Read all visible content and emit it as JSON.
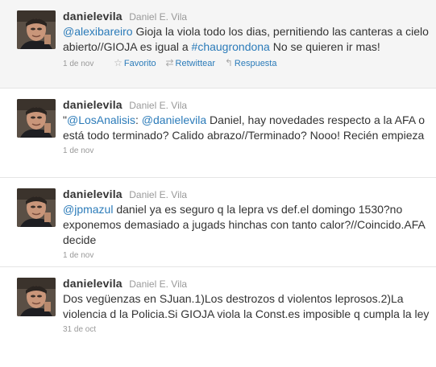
{
  "colors": {
    "link": "#2b7bb9",
    "text": "#333333",
    "muted": "#999999",
    "hover_bg": "#f5f5f5"
  },
  "tweets": [
    {
      "screen_name": "danielevila",
      "full_name": "Daniel E. Vila",
      "avatar_icon": "user-avatar-photo",
      "parts": [
        {
          "kind": "mention",
          "text": "@alexibareiro"
        },
        {
          "kind": "text",
          "text": " Gioja la viola todo los dias, pernitiendo las canteras a cielo abierto//GIOJA es igual a "
        },
        {
          "kind": "hashtag",
          "text": "#chaugrondona"
        },
        {
          "kind": "text",
          "text": " No se quieren ir mas!"
        }
      ],
      "timestamp": "1 de nov",
      "actions": {
        "favorite": "Favorito",
        "retweet": "Retwittear",
        "reply": "Respuesta",
        "favorite_icon": "star-icon",
        "retweet_icon": "retweet-icon",
        "reply_icon": "reply-arrow-icon"
      }
    },
    {
      "screen_name": "danielevila",
      "full_name": "Daniel E. Vila",
      "avatar_icon": "user-avatar-photo",
      "parts": [
        {
          "kind": "text",
          "text": "\""
        },
        {
          "kind": "mention",
          "text": "@LosAnalisis"
        },
        {
          "kind": "text",
          "text": ": "
        },
        {
          "kind": "mention",
          "text": "@danielevila"
        },
        {
          "kind": "text",
          "text": " Daniel, hay novedades respecto a la AFA o está todo terminado? Calido abrazo//Terminado? Nooo! Recién empieza"
        }
      ],
      "timestamp": "1 de nov"
    },
    {
      "screen_name": "danielevila",
      "full_name": "Daniel E. Vila",
      "avatar_icon": "user-avatar-photo",
      "parts": [
        {
          "kind": "mention",
          "text": "@jpmazul"
        },
        {
          "kind": "text",
          "text": " daniel ya es seguro q la lepra vs def.el domingo 1530?no exponemos demasiado a jugads hinchas con tanto calor?//Coincido.AFA decide"
        }
      ],
      "timestamp": "1 de nov"
    },
    {
      "screen_name": "danielevila",
      "full_name": "Daniel E. Vila",
      "avatar_icon": "user-avatar-photo",
      "parts": [
        {
          "kind": "text",
          "text": "Dos vegüenzas en SJuan.1)Los destrozos d violentos leprosos.2)La violencia d la Policia.Si GIOJA viola la Const.es imposible q cumpla la ley"
        }
      ],
      "timestamp": "31 de oct"
    }
  ]
}
